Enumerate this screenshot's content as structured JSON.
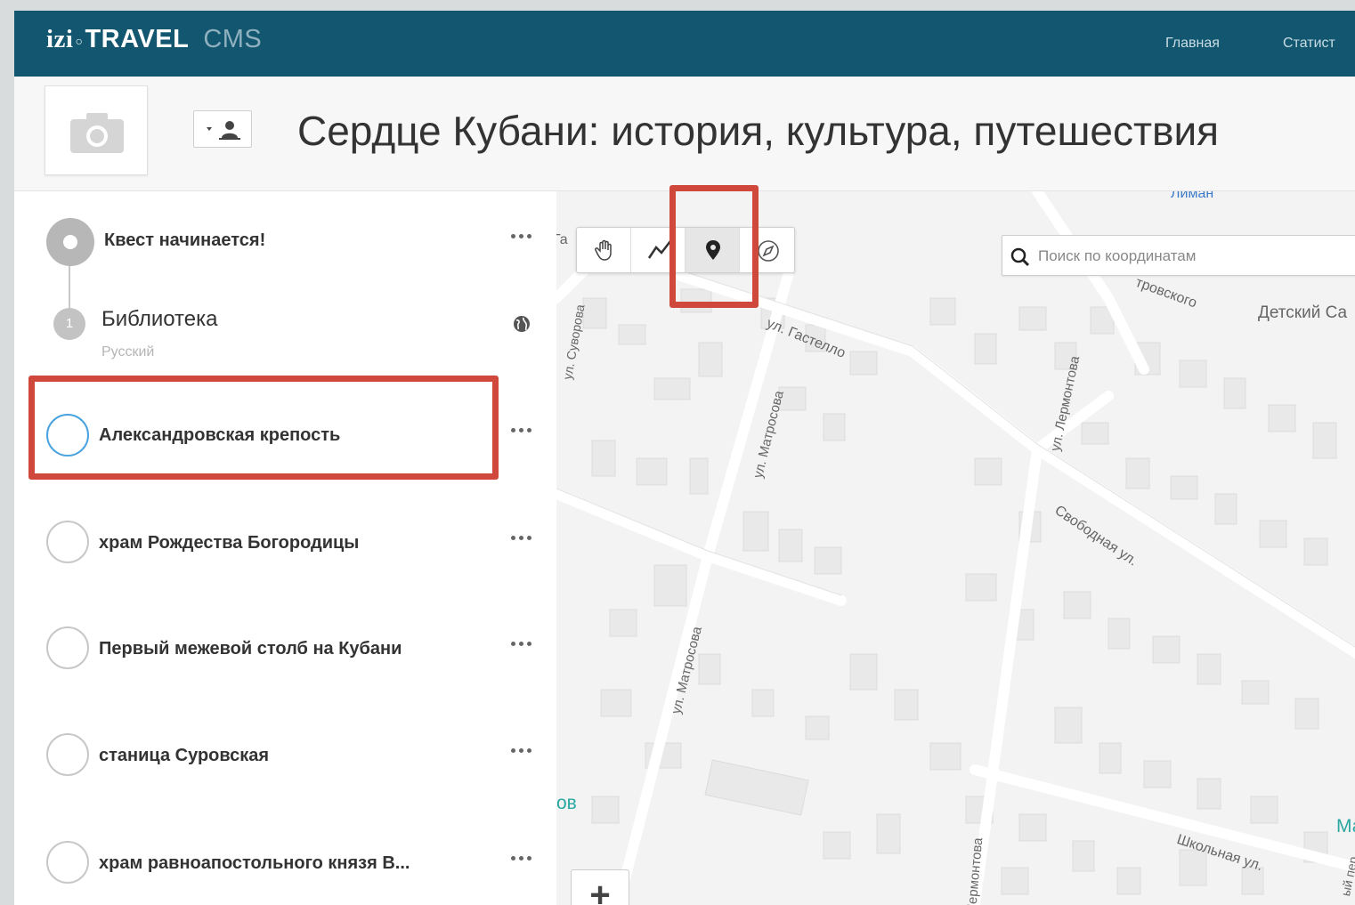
{
  "app": {
    "logo_izi": "izi",
    "logo_travel": "TRAVEL",
    "logo_cms": "CMS"
  },
  "nav": {
    "items": [
      {
        "label": "Главная"
      },
      {
        "label": "Статист"
      }
    ]
  },
  "header": {
    "title": "Сердце Кубани: история, культура, путешествия"
  },
  "sidebar": {
    "start": {
      "label": "Квест начинается!"
    },
    "chapter": {
      "number": "1",
      "title": "Библиотека",
      "language": "Русский"
    },
    "items": [
      {
        "label": "Александровская крепость",
        "active": true
      },
      {
        "label": "храм Рождества Богородицы"
      },
      {
        "label": "Первый межевой столб на Кубани"
      },
      {
        "label": "станица Суровская"
      },
      {
        "label": "храм равноапостольного князя В..."
      }
    ]
  },
  "map": {
    "search_placeholder": "Поиск по координатам",
    "zoom_in_label": "+",
    "labels": {
      "liman": "Лиман",
      "castello": "ул. Гастелло",
      "suvorova": "ул. Суворова",
      "matrosova1": "ул. Матросова",
      "matrosova2": "ул. Матросова",
      "lermontova1": "ул. Лермонтова",
      "lermontova2": "Лермонтова",
      "svobodnaya": "Свободная ул.",
      "shkolnaya": "Школьная ул.",
      "ostrovskogo": "тровского",
      "detsky": "Детский Са",
      "ga": "Га",
      "ov": "ов",
      "ma": "Ма",
      "per": "ый пер."
    }
  },
  "colors": {
    "topbar": "#12566f",
    "highlight": "#d0473b",
    "active_circle": "#4aa3df"
  }
}
